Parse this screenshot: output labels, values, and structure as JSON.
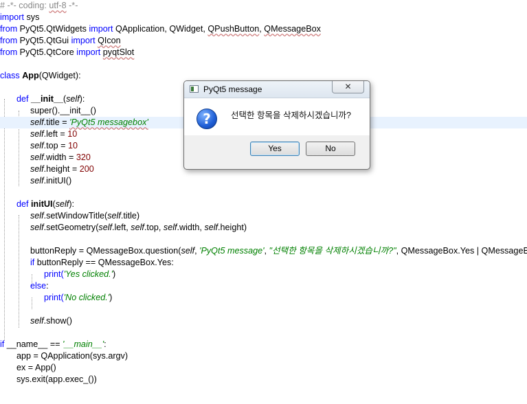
{
  "editor": {
    "l1": {
      "a": "# -*- coding: ",
      "b": "utf-8",
      "c": " -*-"
    },
    "l2": {
      "kw": "import",
      "rest": " sys"
    },
    "l3": {
      "kw1": "from",
      "a": " PyQt5.QtWidgets ",
      "kw2": "import",
      "b": " QApplication, QWidget, ",
      "c": "QPushButton",
      "d": ", ",
      "e": "QMessageBox"
    },
    "l4": {
      "kw1": "from",
      "a": " PyQt5.QtGui ",
      "kw2": "import",
      "b": " ",
      "c": "QIcon"
    },
    "l5": {
      "kw1": "from",
      "a": " PyQt5.QtCore ",
      "kw2": "import",
      "b": " ",
      "c": "pyqtSlot"
    },
    "l7": {
      "kw": "class",
      "name": "App",
      "rest": "(QWidget):"
    },
    "l9": {
      "kw": "def",
      "name": "__init__",
      "a": "(",
      "self": "self",
      "b": "):"
    },
    "l10": "super().__init__()",
    "l11": {
      "self": "self",
      "a": ".title = ",
      "str": "'PyQt5 messagebox'"
    },
    "l12": {
      "self": "self",
      "a": ".left = ",
      "num": "10"
    },
    "l13": {
      "self": "self",
      "a": ".top = ",
      "num": "10"
    },
    "l14": {
      "self": "self",
      "a": ".width = ",
      "num": "320"
    },
    "l15": {
      "self": "self",
      "a": ".height = ",
      "num": "200"
    },
    "l16": {
      "self": "self",
      "a": ".initUI()"
    },
    "l18": {
      "kw": "def",
      "name": "initUI",
      "a": "(",
      "self": "self",
      "b": "):"
    },
    "l19": {
      "self": "self",
      "a": ".setWindowTitle(",
      "self2": "self",
      "b": ".title)"
    },
    "l20": {
      "self": "self",
      "a": ".setGeometry(",
      "s1": "self",
      "b": ".left, ",
      "s2": "self",
      "c": ".top, ",
      "s3": "self",
      "d": ".width, ",
      "s4": "self",
      "e": ".height)"
    },
    "l22": {
      "a": "buttonReply = QMessageBox.question(",
      "self": "self",
      "b": ", ",
      "str1": "'PyQt5 message'",
      "c": ", ",
      "str2": "\"선택한 항목을 삭제하시겠습니까?\"",
      "d": ", QMessageBox.Yes | QMessageBox.No"
    },
    "l23": {
      "kw": "if",
      "rest": " buttonReply == QMessageBox.Yes:"
    },
    "l24": {
      "a": "print(",
      "str": "'Yes clicked.'",
      "b": ")"
    },
    "l25": {
      "kw": "else",
      "rest": ":"
    },
    "l26": {
      "a": "print(",
      "str": "'No clicked.'",
      "b": ")"
    },
    "l28": {
      "self": "self",
      "a": ".show()"
    },
    "l30": {
      "kw": "if",
      "a": " __name__ == ",
      "str": "'__main__'",
      "b": ":"
    },
    "l31": "app = QApplication(sys.argv)",
    "l32": "ex = App()",
    "l33": "sys.exit(app.exec_())"
  },
  "dialog": {
    "title": "PyQt5 message",
    "close_label": "✕",
    "icon": "question-icon",
    "icon_glyph": "?",
    "message": "선택한 항목을 삭제하시겠습니까?",
    "yes_label": "Yes",
    "no_label": "No"
  }
}
